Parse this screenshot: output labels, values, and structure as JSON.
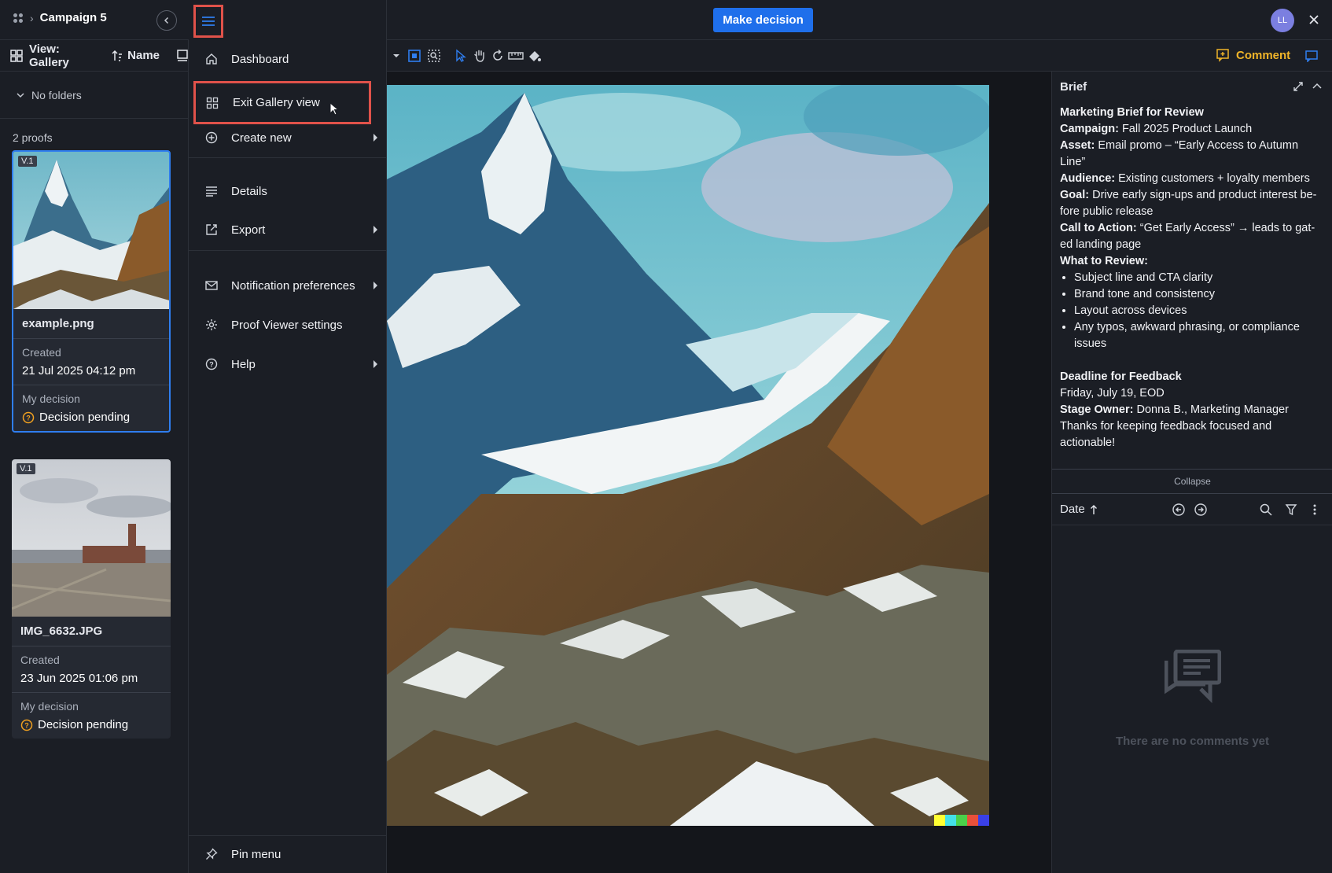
{
  "header": {
    "breadcrumb_title": "Campaign 5",
    "make_decision_label": "Make decision",
    "avatar_initials": "LL"
  },
  "sidebar": {
    "view_label": "View: Gallery",
    "sort_label": "Name",
    "folders_label": "No folders",
    "proofs_count": "2 proofs",
    "proofs": [
      {
        "version": "V.1",
        "filename": "example.png",
        "created_label": "Created",
        "created_value": "21 Jul 2025 04:12 pm",
        "decision_label": "My decision",
        "decision_value": "Decision pending"
      },
      {
        "version": "V.1",
        "filename": "IMG_6632.JPG",
        "created_label": "Created",
        "created_value": "23 Jun 2025 01:06 pm",
        "decision_label": "My decision",
        "decision_value": "Decision pending"
      }
    ]
  },
  "menu": {
    "items": [
      {
        "label": "Dashboard",
        "icon": "home-icon"
      },
      {
        "label": "Exit Gallery view",
        "icon": "grid-icon"
      },
      {
        "label": "Create new",
        "icon": "plus-circle-icon"
      },
      {
        "label": "Details",
        "icon": "lines-icon"
      },
      {
        "label": "Export",
        "icon": "export-icon"
      },
      {
        "label": "Notification preferences",
        "icon": "mail-icon"
      },
      {
        "label": "Proof Viewer settings",
        "icon": "gear-icon"
      },
      {
        "label": "Help",
        "icon": "help-icon"
      }
    ],
    "pin_label": "Pin menu"
  },
  "right_panel": {
    "comment_label": "Comment",
    "brief_title": "Brief",
    "brief": {
      "heading": "Marketing Brief for Review",
      "campaign_label": "Campaign:",
      "campaign_value": " Fall 2025 Product Launch",
      "asset_label": "Asset:",
      "asset_value": " Email promo – “Early Access to Autumn Line”",
      "audience_label": "Audience:",
      "audience_value": " Existing customers + loyalty members",
      "goal_label": "Goal:",
      "goal_value": " Drive early sign-ups and product interest be-fore public release",
      "cta_label": "Call to Action:",
      "cta_value": " “Get Early Access” → leads to gat-ed landing page",
      "review_label": "What to Review:",
      "review_items": [
        "Subject line and CTA clarity",
        "Brand tone and consistency",
        "Layout across devices",
        "Any typos, awkward phrasing, or compliance issues"
      ],
      "deadline_label": "Deadline for Feedback",
      "deadline_value": "Friday, July 19, EOD",
      "owner_label": "Stage Owner:",
      "owner_value": " Donna B., Marketing Manager",
      "thanks": "Thanks for keeping feedback focused and actionable!"
    },
    "collapse_label": "Collapse",
    "sort_label": "Date",
    "empty_text": "There are no comments yet"
  },
  "colors": {
    "accent_blue": "#1f6feb",
    "highlight_red": "#e0524a",
    "comment_yellow": "#f0b429",
    "pending_orange": "#f0a020"
  }
}
